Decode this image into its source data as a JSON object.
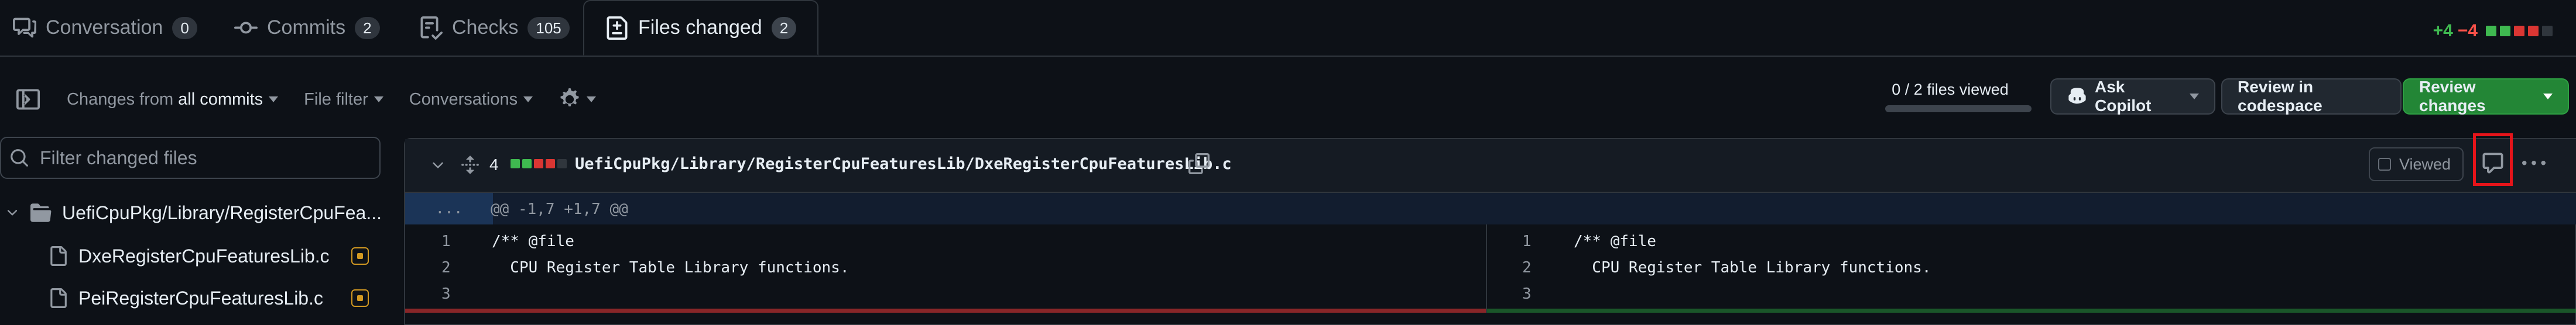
{
  "tabs": {
    "conversation": {
      "label": "Conversation",
      "count": "0"
    },
    "commits": {
      "label": "Commits",
      "count": "2"
    },
    "checks": {
      "label": "Checks",
      "count": "105"
    },
    "files": {
      "label": "Files changed",
      "count": "2"
    }
  },
  "diffstat": {
    "additions": "+4",
    "deletions": "−4"
  },
  "toolbar": {
    "changes_from": "Changes from",
    "all_commits": "all commits",
    "file_filter": "File filter",
    "conversations": "Conversations",
    "files_viewed": "0 / 2 files viewed",
    "ask_copilot": "Ask Copilot",
    "review_codespace": "Review in codespace",
    "review_changes": "Review changes"
  },
  "sidebar": {
    "filter_placeholder": "Filter changed files",
    "folder": "UefiCpuPkg/Library/RegisterCpuFea...",
    "files": [
      "DxeRegisterCpuFeaturesLib.c",
      "PeiRegisterCpuFeaturesLib.c"
    ]
  },
  "diff": {
    "changes": "4",
    "path": "UefiCpuPkg/Library/RegisterCpuFeaturesLib/DxeRegisterCpuFeaturesLib.c",
    "viewed_label": "Viewed",
    "hunk_expand": "...",
    "hunk": "@@ -1,7 +1,7 @@",
    "left_lines": [
      {
        "num": "1",
        "code": "/** @file"
      },
      {
        "num": "2",
        "code": "  CPU Register Table Library functions."
      },
      {
        "num": "3",
        "code": ""
      }
    ],
    "right_lines": [
      {
        "num": "1",
        "code": "/** @file"
      },
      {
        "num": "2",
        "code": "  CPU Register Table Library functions."
      },
      {
        "num": "3",
        "code": ""
      }
    ]
  },
  "colors": {
    "accent_green": "#238636",
    "deletion_red": "#da3633",
    "highlight_box": "#e5141a"
  }
}
